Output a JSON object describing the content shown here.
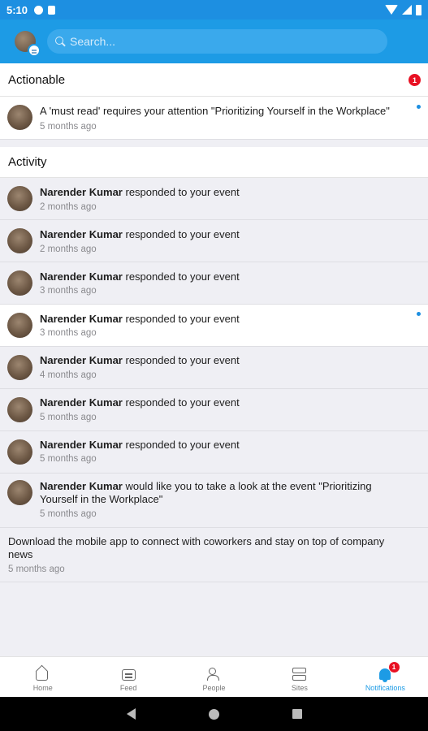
{
  "status_bar": {
    "time": "5:10"
  },
  "header": {
    "search_placeholder": "Search..."
  },
  "actionable": {
    "heading": "Actionable",
    "badge": "1",
    "items": [
      {
        "text": "A 'must read' requires your attention \"Prioritizing Yourself in the Workplace\"",
        "time": "5 months ago",
        "unread": true
      }
    ]
  },
  "activity": {
    "heading": "Activity",
    "items": [
      {
        "name": "Narender Kumar",
        "action": " responded to your event",
        "time": "2 months ago"
      },
      {
        "name": "Narender Kumar",
        "action": " responded to your event",
        "time": "2 months ago"
      },
      {
        "name": "Narender Kumar",
        "action": " responded to your event",
        "time": "3 months ago"
      },
      {
        "name": "Narender Kumar",
        "action": " responded to your event",
        "time": "3 months ago",
        "unread": true
      },
      {
        "name": "Narender Kumar",
        "action": " responded to your event",
        "time": "4 months ago"
      },
      {
        "name": "Narender Kumar",
        "action": " responded to your event",
        "time": "5 months ago"
      },
      {
        "name": "Narender Kumar",
        "action": " responded to your event",
        "time": "5 months ago"
      },
      {
        "name": "Narender Kumar",
        "action": " would like you to take a look at the event \"Prioritizing Yourself in the Workplace\"",
        "time": "5 months ago"
      },
      {
        "text": "Download the mobile app to connect with coworkers and stay on top of company news",
        "time": "5 months ago"
      }
    ]
  },
  "bottom_nav": {
    "items": [
      {
        "label": "Home",
        "icon": "home-icon"
      },
      {
        "label": "Feed",
        "icon": "feed-icon"
      },
      {
        "label": "People",
        "icon": "people-icon"
      },
      {
        "label": "Sites",
        "icon": "sites-icon"
      },
      {
        "label": "Notifications",
        "icon": "bell-icon",
        "badge": "1",
        "active": true
      }
    ]
  },
  "colors": {
    "accent": "#1d9be5",
    "badge": "#e81123",
    "unread_dot": "#1d8fe1"
  }
}
